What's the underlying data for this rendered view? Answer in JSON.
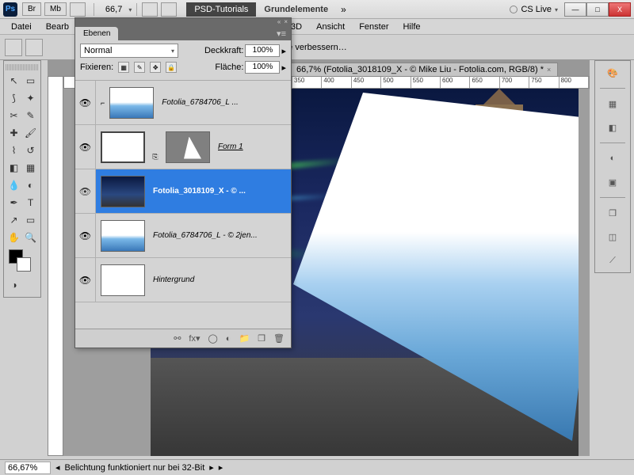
{
  "titlebar": {
    "app_label": "Ps",
    "badges": [
      "Br",
      "Mb"
    ],
    "zoom": "66,7",
    "breadcrumb1": "PSD-Tutorials",
    "breadcrumb2": "Grundelemente",
    "cslive": "CS Live",
    "min": "—",
    "max": "□",
    "close": "X"
  },
  "menu": [
    "Datei",
    "Bearb",
    "",
    "",
    "",
    "",
    "3D",
    "Ansicht",
    "Fenster",
    "Hilfe"
  ],
  "optbar": {
    "hint": "nte verbessern…"
  },
  "doctab": {
    "label": "66,7% (Fotolia_3018109_X - © Mike Liu - Fotolia.com, RGB/8) *"
  },
  "ruler_ticks": [
    "350",
    "400",
    "450",
    "500",
    "550",
    "600",
    "650",
    "700",
    "750",
    "800"
  ],
  "layers_panel": {
    "tab": "Ebenen",
    "blend_mode": "Normal",
    "opacity_label": "Deckkraft:",
    "opacity_value": "100%",
    "fill_label": "Fläche:",
    "fill_value": "100%",
    "lock_label": "Fixieren:",
    "layers": [
      {
        "name": "Fotolia_6784706_L ...",
        "thumb": "water",
        "mask": true,
        "clip": true
      },
      {
        "name": "Form 1",
        "thumb": "outline",
        "mask": "shape",
        "underline": true
      },
      {
        "name": "Fotolia_3018109_X - © ...",
        "thumb": "city",
        "selected": true
      },
      {
        "name": "Fotolia_6784706_L - © 2jen...",
        "thumb": "water"
      },
      {
        "name": "Hintergrund",
        "thumb": "blank",
        "italic": true
      }
    ]
  },
  "status": {
    "pct": "66,67%",
    "msg": "Belichtung funktioniert nur bei 32-Bit"
  }
}
